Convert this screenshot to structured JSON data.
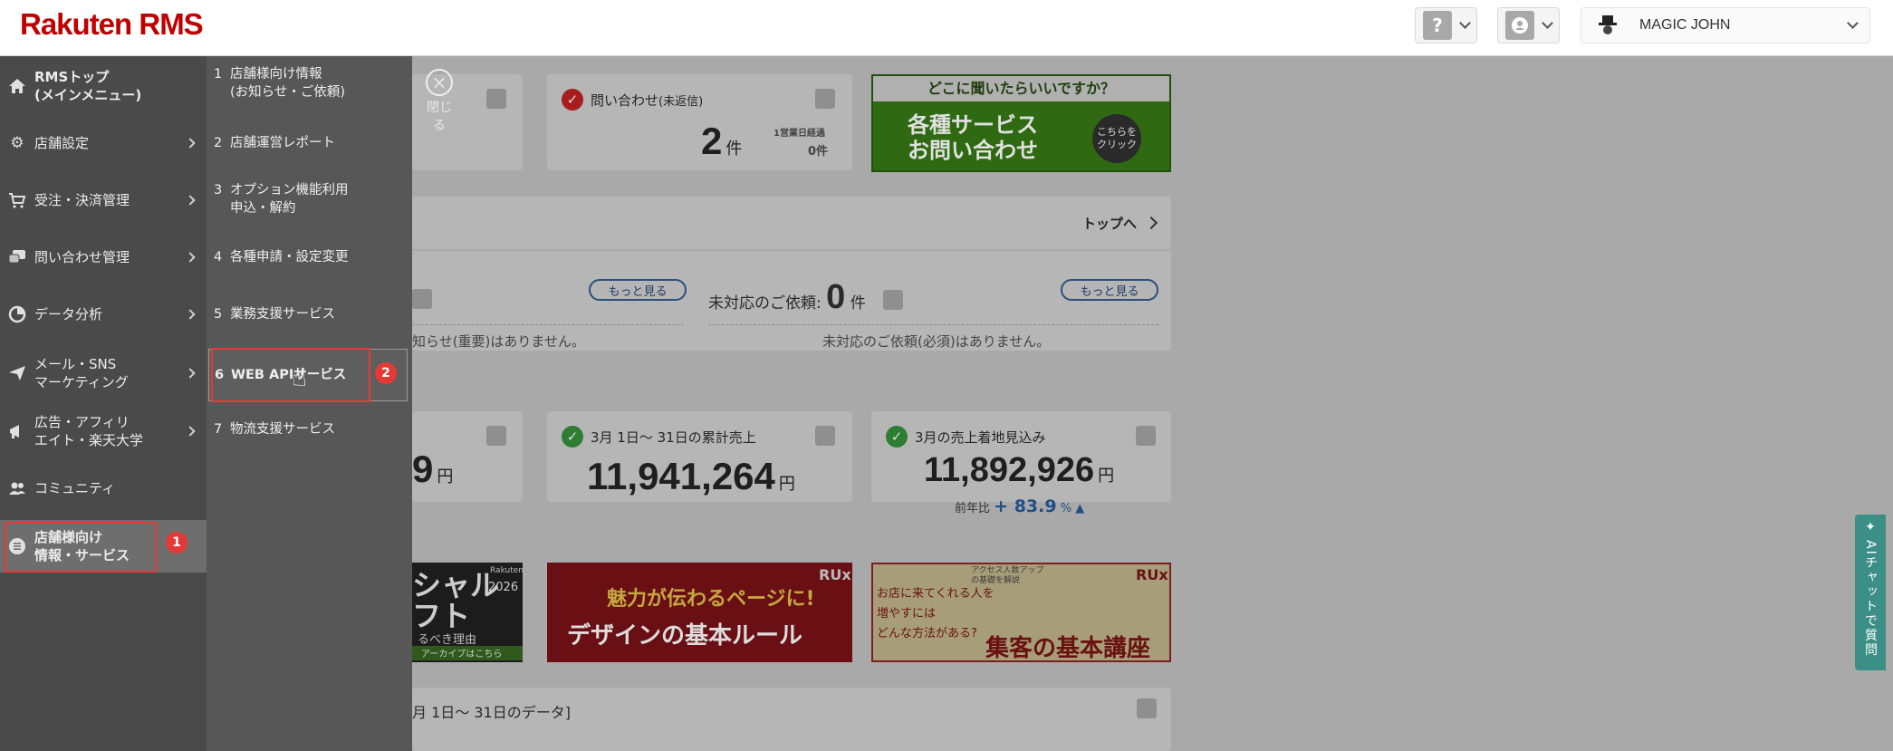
{
  "header": {
    "logo": "Rakuten RMS",
    "help_icon": "?",
    "user_name": "MAGIC JOHN"
  },
  "nav": {
    "items": [
      {
        "label": "RMSトップ\n(メインメニュー)",
        "icon": "home-icon"
      },
      {
        "label": "店舗設定",
        "icon": "gear-icon"
      },
      {
        "label": "受注・決済管理",
        "icon": "cart-icon"
      },
      {
        "label": "問い合わせ管理",
        "icon": "chat-icon"
      },
      {
        "label": "データ分析",
        "icon": "pie-icon"
      },
      {
        "label": "メール・SNS\nマーケティング",
        "icon": "send-icon"
      },
      {
        "label": "広告・アフィリ\nエイト・楽天大学",
        "icon": "megaphone-icon"
      },
      {
        "label": "コミュニティ",
        "icon": "people-icon"
      },
      {
        "label": "店舗様向け\n情報・サービス",
        "icon": "list-icon"
      }
    ],
    "sub_items": [
      {
        "num": "1",
        "label": "店舗様向け情報\n(お知らせ・ご依頼)"
      },
      {
        "num": "2",
        "label": "店舗運営レポート"
      },
      {
        "num": "3",
        "label": "オプション機能利用\n申込・解約"
      },
      {
        "num": "4",
        "label": "各種申請・設定変更"
      },
      {
        "num": "5",
        "label": "業務支援サービス"
      },
      {
        "num": "6",
        "label": "WEB APIサービス"
      },
      {
        "num": "7",
        "label": "物流支援サービス"
      }
    ],
    "close_label": "閉じる",
    "step1": "1",
    "step2": "2"
  },
  "main": {
    "inquiry_title": "問い合わせ",
    "inquiry_sub": "(未返信)",
    "inquiry_count": "2",
    "inquiry_unit": "件",
    "business_day_label": "1営業日経過",
    "business_day_value": "0件",
    "banner_top_line": "どこに聞いたらいいですか？",
    "banner_main": "各種サービス\nお問い合わせ",
    "banner_click": "こちらを\nクリック",
    "top_link": "トップへ",
    "more1": "もっと見る",
    "more2": "もっと見る",
    "pending_label": "未対応のご依頼:",
    "pending_count": "0",
    "pending_unit": "件",
    "notice_none": "知らせ(重要)はありません。",
    "pending_none": "未対応のご依頼(必須)はありません。",
    "partial_sales": "9",
    "partial_unit": "円",
    "cum_sales_title": "3月 1日〜 31日の累計売上",
    "cum_sales_value": "11,941,264",
    "cum_sales_unit": "円",
    "forecast_title": "3月の売上着地見込み",
    "forecast_value": "11,892,926",
    "forecast_unit": "円",
    "yoy_label": "前年比",
    "yoy_value": "+ 83.9",
    "yoy_unit": "%",
    "promo1_top": "Rakuten",
    "promo1_year": "2026",
    "promo1_text": "シャル\nフト",
    "promo1_sub": "るべき理由",
    "promo1_archive": "アーカイブはこちら",
    "promo2_text1": "魅力が伝わるページに!",
    "promo2_text2": "デザインの基本ルール",
    "promo2_brand": "RUx",
    "promo3_small": "アクセス人数アップ\nの基礎を解説",
    "promo3_q": "お店に来てくれる人を\n増やすには\nどんな方法がある?",
    "promo3_main": "集客の基本講座",
    "promo3_brand": "RUx",
    "data_period": "月 1日〜 31日のデータ]"
  },
  "ai_chat": {
    "label": "AIチャットで質問"
  }
}
